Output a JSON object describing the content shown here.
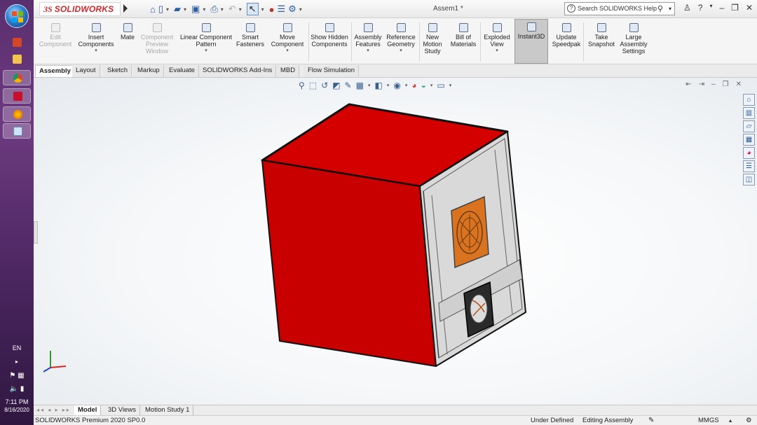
{
  "taskbar": {
    "language": "EN",
    "time": "7:11 PM",
    "date": "8/16/2020"
  },
  "app": {
    "logo_prefix": "3S",
    "logo_text": "SOLIDWORKS",
    "document_title": "Assem1 *",
    "search_placeholder": "Search SOLIDWORKS Help"
  },
  "ribbon": {
    "commands": [
      {
        "label": "Edit Component",
        "enabled": false
      },
      {
        "label": "Insert Components",
        "enabled": true
      },
      {
        "label": "Mate",
        "enabled": true
      },
      {
        "label": "Component Preview Window",
        "enabled": false
      },
      {
        "label": "Linear Component Pattern",
        "enabled": true
      },
      {
        "label": "Smart Fasteners",
        "enabled": true
      },
      {
        "label": "Move Component",
        "enabled": true
      },
      {
        "label": "Show Hidden Components",
        "enabled": true
      },
      {
        "label": "Assembly Features",
        "enabled": true
      },
      {
        "label": "Reference Geometry",
        "enabled": true
      },
      {
        "label": "New Motion Study",
        "enabled": true
      },
      {
        "label": "Bill of Materials",
        "enabled": true
      },
      {
        "label": "Exploded View",
        "enabled": true
      },
      {
        "label": "Instant3D",
        "enabled": true,
        "pressed": true
      },
      {
        "label": "Update Speedpak",
        "enabled": true
      },
      {
        "label": "Take Snapshot",
        "enabled": true
      },
      {
        "label": "Large Assembly Settings",
        "enabled": true
      }
    ]
  },
  "tabs": [
    "Assembly",
    "Layout",
    "Sketch",
    "Markup",
    "Evaluate",
    "SOLIDWORKS Add-Ins",
    "MBD",
    "Flow Simulation"
  ],
  "bottom_tabs": [
    "Model",
    "3D Views",
    "Motion Study 1"
  ],
  "status": {
    "product": "SOLIDWORKS Premium 2020 SP0.0",
    "state": "Under Defined",
    "mode": "Editing Assembly",
    "units": "MMGS"
  },
  "colors": {
    "box_red": "#d40000",
    "panel_gray": "#dcdcdc",
    "fan_orange": "#d9731f"
  }
}
